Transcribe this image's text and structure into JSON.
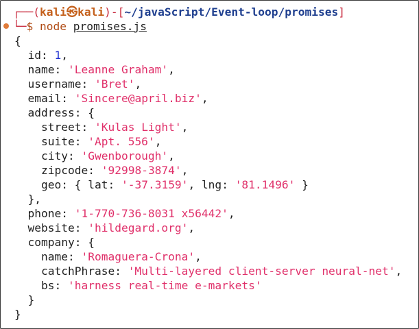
{
  "terminal": {
    "prompt": {
      "box_start": "┌──(",
      "user": "kali",
      "at_symbol": "㉿",
      "host": "kali",
      "sep": ")-[",
      "cwd": "~/javaScript/Event-loop/promises",
      "end": "]",
      "second_start": "└─",
      "dollar": "$",
      "command": "node",
      "arg": "promises.js"
    },
    "output": {
      "open_brace": "{",
      "id_key": "id",
      "id_value": "1",
      "name_key": "name",
      "name_value": "'Leanne Graham'",
      "username_key": "username",
      "username_value": "'Bret'",
      "email_key": "email",
      "email_value": "'Sincere@april.biz'",
      "address_key": "address",
      "street_key": "street",
      "street_value": "'Kulas Light'",
      "suite_key": "suite",
      "suite_value": "'Apt. 556'",
      "city_key": "city",
      "city_value": "'Gwenborough'",
      "zipcode_key": "zipcode",
      "zipcode_value": "'92998-3874'",
      "geo_key": "geo",
      "lat_key": "lat",
      "lat_value": "'-37.3159'",
      "lng_key": "lng",
      "lng_value": "'81.1496'",
      "phone_key": "phone",
      "phone_value": "'1-770-736-8031 x56442'",
      "website_key": "website",
      "website_value": "'hildegard.org'",
      "company_key": "company",
      "company_name_key": "name",
      "company_name_value": "'Romaguera-Crona'",
      "catch_key": "catchPhrase",
      "catch_value": "'Multi-layered client-server neural-net'",
      "bs_key": "bs",
      "bs_value": "'harness real-time e-markets'",
      "close_brace": "}"
    },
    "colors": {
      "string": "#e0306a",
      "number": "#1d2fd0",
      "prompt_frame": "#c8283c",
      "prompt_user": "#c45f1a",
      "prompt_path": "#1f3f8f",
      "status_dot": "#e07b39"
    }
  }
}
